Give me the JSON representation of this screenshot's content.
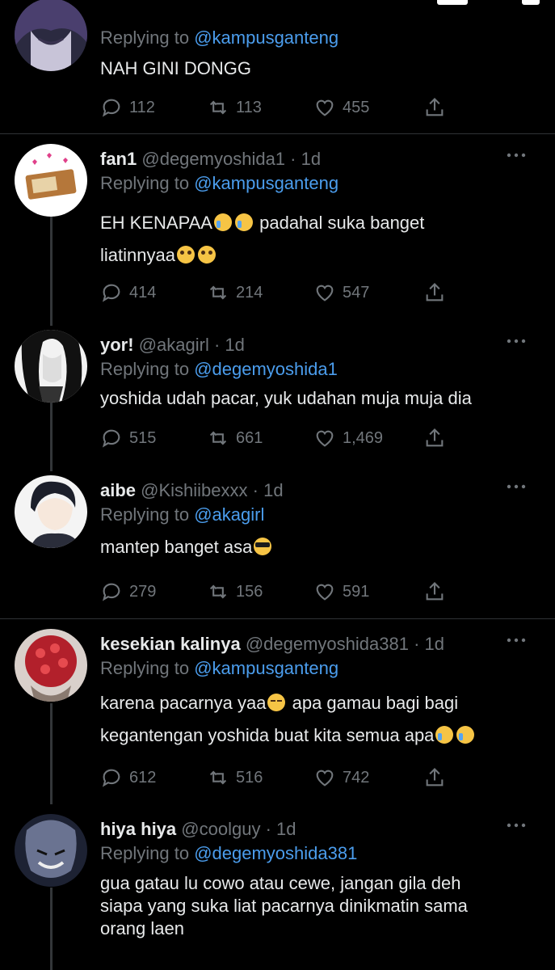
{
  "tweets": [
    {
      "name": "",
      "handle": "",
      "time": "",
      "replying_label": "Replying to",
      "reply_to": "@kampusganteng",
      "lines": [
        "NAH GINI DONGG"
      ],
      "replies": "112",
      "retweets": "113",
      "likes": "455"
    },
    {
      "name": "fan1",
      "handle": "@degemyoshida1",
      "time": "1d",
      "replying_label": "Replying to",
      "reply_to": "@kampusganteng",
      "lines": [
        "EH KENAPAA",
        "padahal suka banget",
        "liatinnyaa"
      ],
      "replies": "414",
      "retweets": "214",
      "likes": "547"
    },
    {
      "name": "yor!",
      "handle": "@akagirl",
      "time": "1d",
      "replying_label": "Replying to",
      "reply_to": "@degemyoshida1",
      "lines": [
        "yoshida udah pacar, yuk udahan muja muja dia"
      ],
      "replies": "515",
      "retweets": "661",
      "likes": "1,469"
    },
    {
      "name": "aibe",
      "handle": "@Kishiibexxx",
      "time": "1d",
      "replying_label": "Replying to",
      "reply_to": "@akagirl",
      "lines": [
        "mantep banget asa"
      ],
      "replies": "279",
      "retweets": "156",
      "likes": "591"
    },
    {
      "name": "kesekian kalinya",
      "handle": "@degemyoshida381",
      "time": "1d",
      "replying_label": "Replying to",
      "reply_to": "@kampusganteng",
      "lines": [
        "karena pacarnya yaa",
        "apa gamau bagi bagi",
        "kegantengan yoshida buat kita semua apa"
      ],
      "replies": "612",
      "retweets": "516",
      "likes": "742"
    },
    {
      "name": "hiya hiya",
      "handle": "@coolguy",
      "time": "1d",
      "replying_label": "Replying to",
      "reply_to": "@degemyoshida381",
      "lines": [
        "gua gatau lu cowo atau cewe, jangan gila deh",
        "siapa yang suka liat pacarnya dinikmatin sama",
        "orang laen"
      ]
    }
  ],
  "icons": {
    "reply": "reply-icon",
    "retweet": "retweet-icon",
    "like": "heart-icon",
    "share": "share-icon",
    "more": "more-icon"
  },
  "colors": {
    "background": "#000000",
    "text": "#e7e9ea",
    "muted": "#71767b",
    "link": "#4b9ded",
    "divider": "#2f3336"
  }
}
